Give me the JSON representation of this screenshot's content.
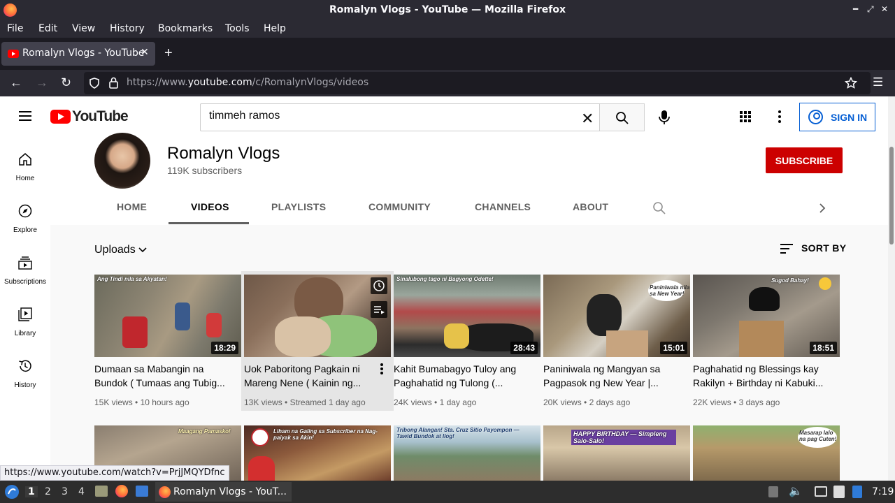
{
  "window": {
    "title": "Romalyn Vlogs - YouTube — Mozilla Firefox"
  },
  "menubar": [
    "File",
    "Edit",
    "View",
    "History",
    "Bookmarks",
    "Tools",
    "Help"
  ],
  "tab": {
    "label": "Romalyn Vlogs - YouTube"
  },
  "address": {
    "prefix": "https://www.",
    "domain": "youtube.com",
    "path": "/c/RomalynVlogs/videos"
  },
  "youtube": {
    "logo_text": "YouTube",
    "search_value": "timmeh ramos",
    "signin": "SIGN IN",
    "guide": [
      "Home",
      "Explore",
      "Subscriptions",
      "Library",
      "History"
    ]
  },
  "channel": {
    "name": "Romalyn Vlogs",
    "subscribers": "119K subscribers",
    "subscribe": "SUBSCRIBE",
    "tabs": [
      "HOME",
      "VIDEOS",
      "PLAYLISTS",
      "COMMUNITY",
      "CHANNELS",
      "ABOUT"
    ]
  },
  "uploads_label": "Uploads",
  "sort_label": "SORT BY",
  "videos": [
    {
      "title": "Dumaan sa Mabangin na Bundok ( Tumaas ang Tubig...",
      "views": "15K views",
      "age": "10 hours ago",
      "duration": "18:29",
      "caption": "Ang Tindi nila sa Akyatan!"
    },
    {
      "title": "Uok Paboritong Pagkain ni Mareng Nene ( Kainin ng...",
      "views": "13K views",
      "age": "Streamed 1 day ago",
      "duration": "",
      "caption": ""
    },
    {
      "title": "Kahit Bumabagyo Tuloy ang Paghahatid ng Tulong (...",
      "views": "24K views",
      "age": "1 day ago",
      "duration": "28:43",
      "caption": "Sinalubong tago ni Bagyong Odette!"
    },
    {
      "title": "Paniniwala ng Mangyan sa Pagpasok ng New Year |...",
      "views": "20K views",
      "age": "2 days ago",
      "duration": "15:01",
      "caption": "Paniniwala nila sa New Year!"
    },
    {
      "title": "Paghahatid ng Blessings kay Rakilyn + Birthday ni Kabuki...",
      "views": "22K views",
      "age": "3 days ago",
      "duration": "18:51",
      "caption": "Sugod Bahay!"
    }
  ],
  "row2_captions": [
    "Maagang Pamasko!",
    "Liham na Galing sa Subscriber na Nag-paiyak sa Akin!",
    "Tribong Alangan! Sta. Cruz Sitio Payompon — Tawid Bundok at Ilog!",
    "HAPPY BIRTHDAY — Simpleng Salo-Salo!",
    "Masarap lalo na pag Cuten!"
  ],
  "status_url": "https://www.youtube.com/watch?v=PrjJMQYDfnc",
  "taskbar": {
    "workspaces": [
      "1",
      "2",
      "3",
      "4"
    ],
    "app": "Romalyn Vlogs - YouT...",
    "time": "7:19"
  },
  "colors": {
    "subscribe": "#cc0000",
    "signin": "#065fd4",
    "chrome": "#2b2a33"
  }
}
